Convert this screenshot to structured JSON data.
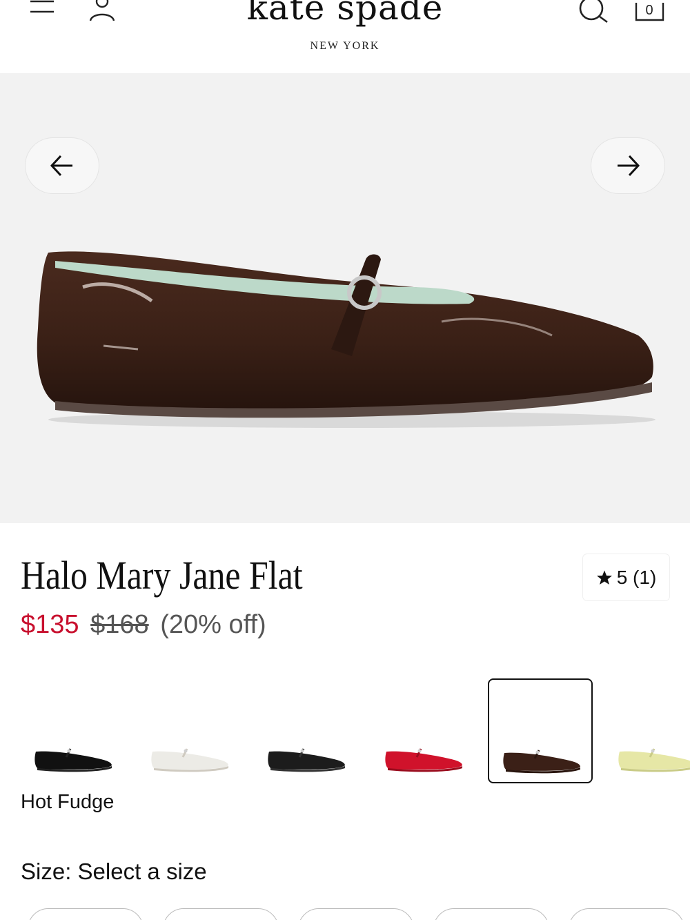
{
  "header": {
    "brand": "kate spade",
    "brand_sub": "NEW YORK",
    "bag_count": "0",
    "icons": [
      "menu-icon",
      "account-icon",
      "search-icon",
      "shopping-bag-icon"
    ]
  },
  "gallery": {
    "prev_icon": "arrow-left-icon",
    "next_icon": "arrow-right-icon"
  },
  "product": {
    "title": "Halo Mary Jane Flat",
    "rating": "5 (1)",
    "price_sale": "$135",
    "price_original": "$168",
    "price_discount": "(20% off)",
    "selected_color": "Hot Fudge"
  },
  "swatches": [
    {
      "color": "#111111",
      "sole": "#222222"
    },
    {
      "color": "#ecebe6",
      "sole": "#cfcac0"
    },
    {
      "color": "#1c1c1c",
      "sole": "#333333"
    },
    {
      "color": "#d0122b",
      "sole": "#9a0c1e"
    },
    {
      "color": "#3b2017",
      "sole": "#2a160f",
      "selected": true
    },
    {
      "color": "#e6e7a6",
      "sole": "#c9cb86"
    }
  ],
  "size": {
    "label": "Size: Select a size"
  },
  "colors": {
    "sale": "#c8102e",
    "gallery_bg": "#f2f2f2"
  }
}
